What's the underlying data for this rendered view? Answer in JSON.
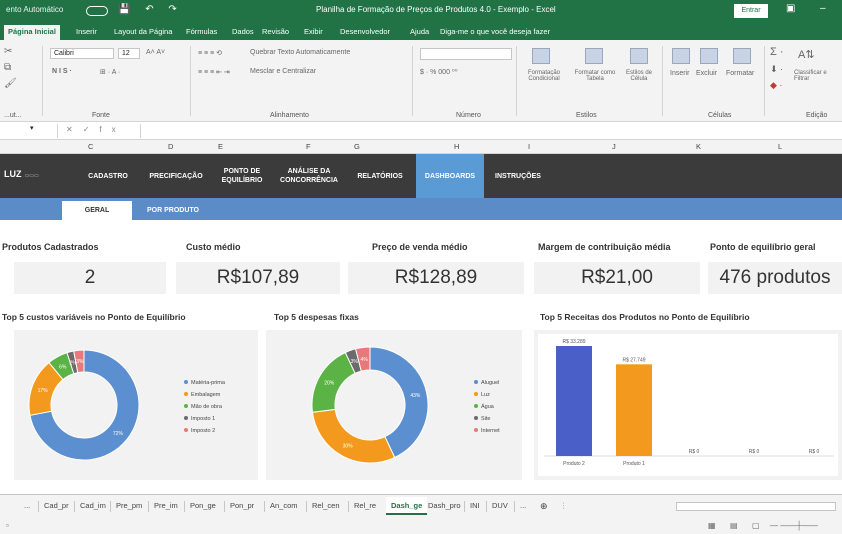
{
  "titlebar": {
    "autosave": "ento Automático",
    "document_title": "Planilha de Formação de Preços de Produtos 4.0 - Exemplo - Excel",
    "enter_label": "Entrar"
  },
  "ribbon_tabs": [
    "Página Inicial",
    "Inserir",
    "Layout da Página",
    "Fórmulas",
    "Dados",
    "Revisão",
    "Exibir",
    "Desenvolvedor",
    "Ajuda",
    "Diga-me o que você deseja fazer"
  ],
  "ribbon": {
    "font_name": "Calibri",
    "font_size": "12",
    "wrap_text": "Quebrar Texto Automaticamente",
    "merge_center": "Mesclar e Centralizar",
    "conditional_format": "Formatação Condicional",
    "format_as_table": "Formatar como Tabela",
    "cell_styles": "Estilos de Célula",
    "insert": "Inserir",
    "delete": "Excluir",
    "format": "Formatar",
    "sort_filter": "Classificar e Filtrar",
    "groups": {
      "clipboard": "...ut... ",
      "font": "Fonte",
      "alignment": "Alinhamento",
      "number": "Número",
      "styles": "Estilos",
      "cells": "Células",
      "editing": "Edição"
    }
  },
  "column_headers": [
    "C",
    "D",
    "E",
    "F",
    "G",
    "H",
    "I",
    "J",
    "K",
    "L"
  ],
  "navbar": {
    "logo": "LUZ",
    "items": [
      "CADASTRO",
      "PRECIFICAÇÃO",
      "PONTO DE EQUILÍBRIO",
      "ANÁLISE DA CONCORRÊNCIA",
      "RELATÓRIOS",
      "DASHBOARDS",
      "INSTRUÇÕES"
    ]
  },
  "subnav": [
    "GERAL",
    "POR PRODUTO"
  ],
  "kpis": [
    {
      "label": "Produtos Cadastrados",
      "value": "2"
    },
    {
      "label": "Custo médio",
      "value": "R$107,89"
    },
    {
      "label": "Preço de venda médio",
      "value": "R$128,89"
    },
    {
      "label": "Margem de contribuição média",
      "value": "R$21,00"
    },
    {
      "label": "Ponto de equilíbrio geral",
      "value": "476 produtos"
    }
  ],
  "chart_titles": [
    "Top 5 custos variáveis no Ponto de Equilíbrio",
    "Top 5 despesas fixas",
    "Top 5 Receitas dos Produtos no Ponto de Equilíbrio"
  ],
  "chart_data": [
    {
      "type": "pie",
      "title": "Top 5 custos variáveis no Ponto de Equilíbrio",
      "labels": [
        "Matéria-prima",
        "Embalagem",
        "Mão de obra",
        "Imposto 1",
        "Imposto 2"
      ],
      "values": [
        72,
        17,
        6,
        2,
        3
      ],
      "value_labels": [
        "72%",
        "17%",
        "6%",
        "2%",
        "3%"
      ],
      "colors": [
        "#5b8fd0",
        "#f39a1e",
        "#5cb345",
        "#6b6b6b",
        "#e8797a"
      ],
      "legend": "right"
    },
    {
      "type": "pie",
      "title": "Top 5 despesas fixas",
      "labels": [
        "Aluguel",
        "Luz",
        "Água",
        "Site",
        "Internet"
      ],
      "values": [
        43,
        30,
        20,
        3,
        4
      ],
      "value_labels": [
        "43%",
        "30%",
        "20%",
        "3%",
        "4%"
      ],
      "colors": [
        "#5b8fd0",
        "#f39a1e",
        "#5cb345",
        "#6b6b6b",
        "#e8797a"
      ],
      "legend": "right"
    },
    {
      "type": "bar",
      "title": "Top 5 Receitas dos Produtos no Ponto de Equilíbrio",
      "categories": [
        "Produto 2",
        "Produto 1",
        "",
        "",
        ""
      ],
      "values": [
        33289,
        27749,
        0,
        0,
        0
      ],
      "value_labels": [
        "R$ 33.289",
        "R$ 27.749",
        "R$ 0",
        "R$ 0",
        "R$ 0"
      ],
      "colors": [
        "#4a5fc8",
        "#f39a1e"
      ]
    }
  ],
  "sheet_tabs": [
    "...",
    "Cad_pr",
    "Cad_im",
    "Pre_pm",
    "Pre_im",
    "Pon_ge",
    "Pon_pr",
    "An_com",
    "Rel_cen",
    "Rel_re",
    "Dash_ge",
    "Dash_pro",
    "INI",
    "DUV",
    "..."
  ],
  "active_sheet": "Dash_ge"
}
